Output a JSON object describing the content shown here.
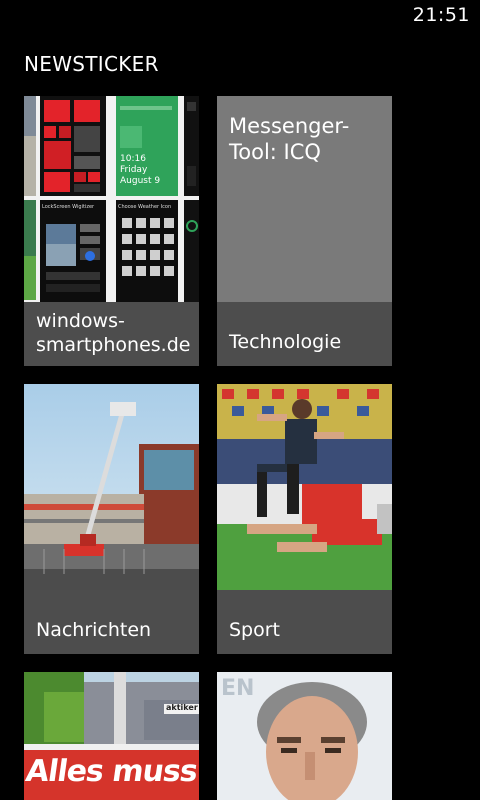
{
  "status": {
    "time": "21:51"
  },
  "header": {
    "title": "NEWSTICKER"
  },
  "tiles": [
    {
      "id": "windows-smartphones",
      "caption": "windows-\nsmartphones.de",
      "caption_line1": "windows-",
      "caption_line2": "smartphones.de",
      "phone_texts": {
        "time": "10:16",
        "day": "Friday",
        "date": "August 9",
        "lockscreen_label": "LockScreen Wigitizer",
        "choose_label": "Choose Weather Icon"
      }
    },
    {
      "id": "technologie",
      "caption": "Technologie",
      "headline_line1": "Messenger-",
      "headline_line2": "Tool: ICQ"
    },
    {
      "id": "nachrichten",
      "caption": "Nachrichten"
    },
    {
      "id": "sport",
      "caption": "Sport"
    },
    {
      "id": "banner-photo",
      "banner_text": "Alles muss ra",
      "store_sign": "aktiker"
    },
    {
      "id": "portrait-photo",
      "sign_text": "EN"
    }
  ],
  "colors": {
    "tile_caption_bg": "#4d4d4d",
    "tech_tile_bg": "#7a7a7a",
    "lock_green": "#2fa35a",
    "accent_red": "#d32f2f"
  }
}
